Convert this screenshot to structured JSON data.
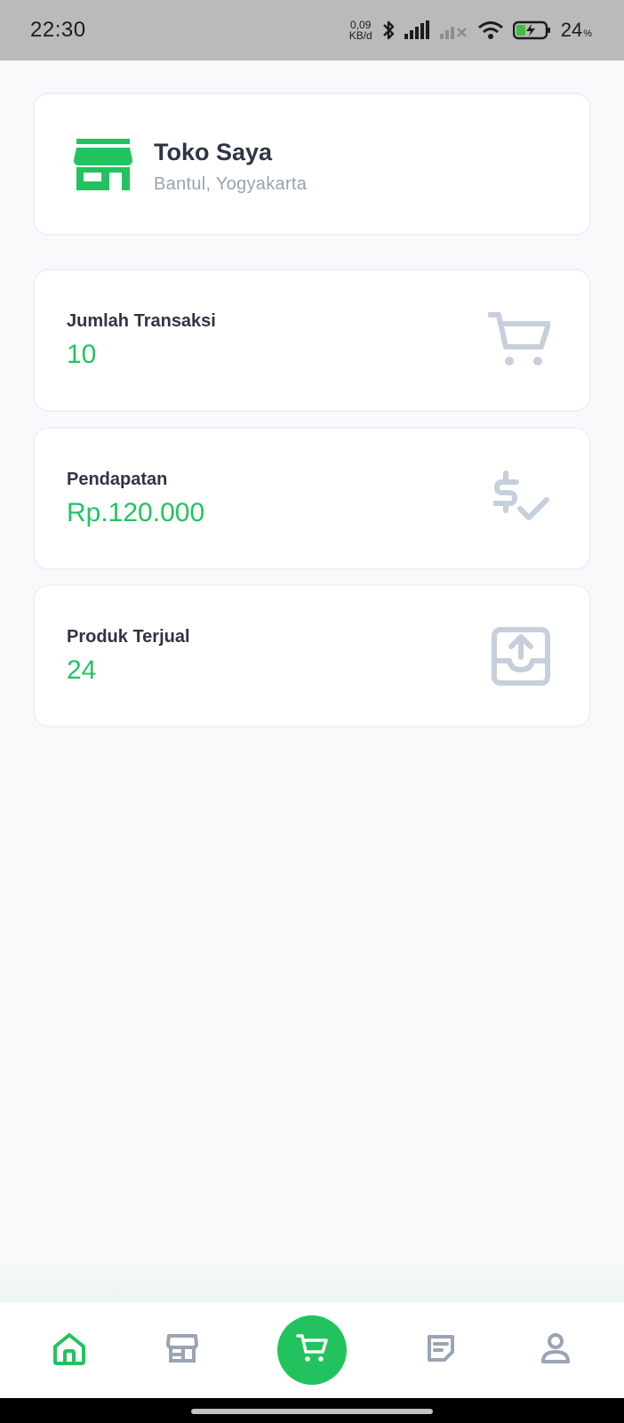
{
  "status_bar": {
    "time": "22:30",
    "net_speed_value": "0,09",
    "net_speed_unit": "KB/d",
    "battery_percent": "24",
    "battery_percent_sign": "%",
    "icons": [
      "bluetooth-icon",
      "signal-icon",
      "signal-no-service-icon",
      "wifi-icon",
      "battery-charging-icon"
    ]
  },
  "store": {
    "name": "Toko Saya",
    "location": "Bantul, Yogyakarta",
    "icon": "store-icon"
  },
  "stats": [
    {
      "label": "Jumlah Transaksi",
      "value": "10",
      "icon": "cart-icon"
    },
    {
      "label": "Pendapatan",
      "value": "Rp.120.000",
      "icon": "dollar-check-icon"
    },
    {
      "label": "Produk Terjual",
      "value": "24",
      "icon": "tray-upload-icon"
    }
  ],
  "bottom_nav": {
    "items": [
      {
        "icon": "home-icon",
        "active": true
      },
      {
        "icon": "store-icon",
        "active": false
      },
      {
        "icon": "cart-icon",
        "active": false,
        "fab": true
      },
      {
        "icon": "notes-icon",
        "active": false
      },
      {
        "icon": "user-icon",
        "active": false
      }
    ]
  },
  "colors": {
    "accent": "#22c35e",
    "muted_icon": "#c6cfdc",
    "nav_icon": "#9aa4b2",
    "background": "#f7f9fb",
    "card": "#ffffff"
  }
}
